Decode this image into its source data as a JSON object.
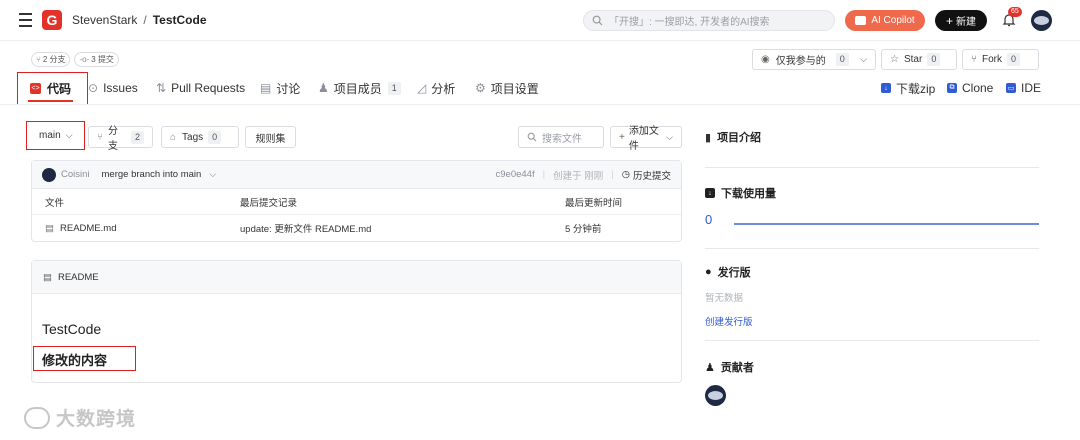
{
  "topbar": {
    "owner": "StevenStark",
    "sep": "/",
    "repo": "TestCode",
    "search_placeholder": "「开搜」: 一搜即达, 开发者的AI搜索",
    "ai_label": "AI Copilot",
    "new_label": "新建",
    "notif_count": "65"
  },
  "repo_meta": {
    "branches": "2 分支",
    "commits": "3 提交"
  },
  "repo_actions": {
    "watch_label": "仅我参与的",
    "watch_count": "0",
    "star_label": "Star",
    "star_count": "0",
    "fork_label": "Fork",
    "fork_count": "0"
  },
  "tabs": [
    {
      "label": "代码"
    },
    {
      "label": "Issues"
    },
    {
      "label": "Pull Requests"
    },
    {
      "label": "讨论"
    },
    {
      "label": "项目成员",
      "count": "1"
    },
    {
      "label": "分析"
    },
    {
      "label": "项目设置"
    }
  ],
  "right_links": {
    "download": "下载zip",
    "clone": "Clone",
    "ide": "IDE"
  },
  "toolbar": {
    "branch": "main",
    "branches_label": "分支",
    "branches_count": "2",
    "tags_label": "Tags",
    "tags_count": "0",
    "rules_label": "规则集",
    "file_search_placeholder": "搜索文件",
    "add_file": "添加文件"
  },
  "commit": {
    "author": "Coisini",
    "message": "merge branch into main",
    "hash": "c9e0e44f",
    "time": "创建于 刚刚",
    "history": "历史提交"
  },
  "file_table": {
    "headers": [
      "文件",
      "最后提交记录",
      "最后更新时间"
    ],
    "rows": [
      {
        "name": "README.md",
        "commit": "update: 更新文件 README.md",
        "time": "5 分钟前"
      }
    ]
  },
  "readme": {
    "header": "README",
    "title": "TestCode",
    "subtitle": "修改的内容"
  },
  "sidebar": {
    "intro": "项目介绍",
    "downloads": "下载使用量",
    "downloads_count": "0",
    "releases": "发行版",
    "no_data": "暂无数据",
    "create_release": "创建发行版",
    "contributors": "贡献者"
  },
  "watermark": "大数跨境",
  "colors": {
    "brand": "#e2332b",
    "ai": "#ef6a4d",
    "link": "#2f5bd3",
    "highlight": "#e02020"
  }
}
